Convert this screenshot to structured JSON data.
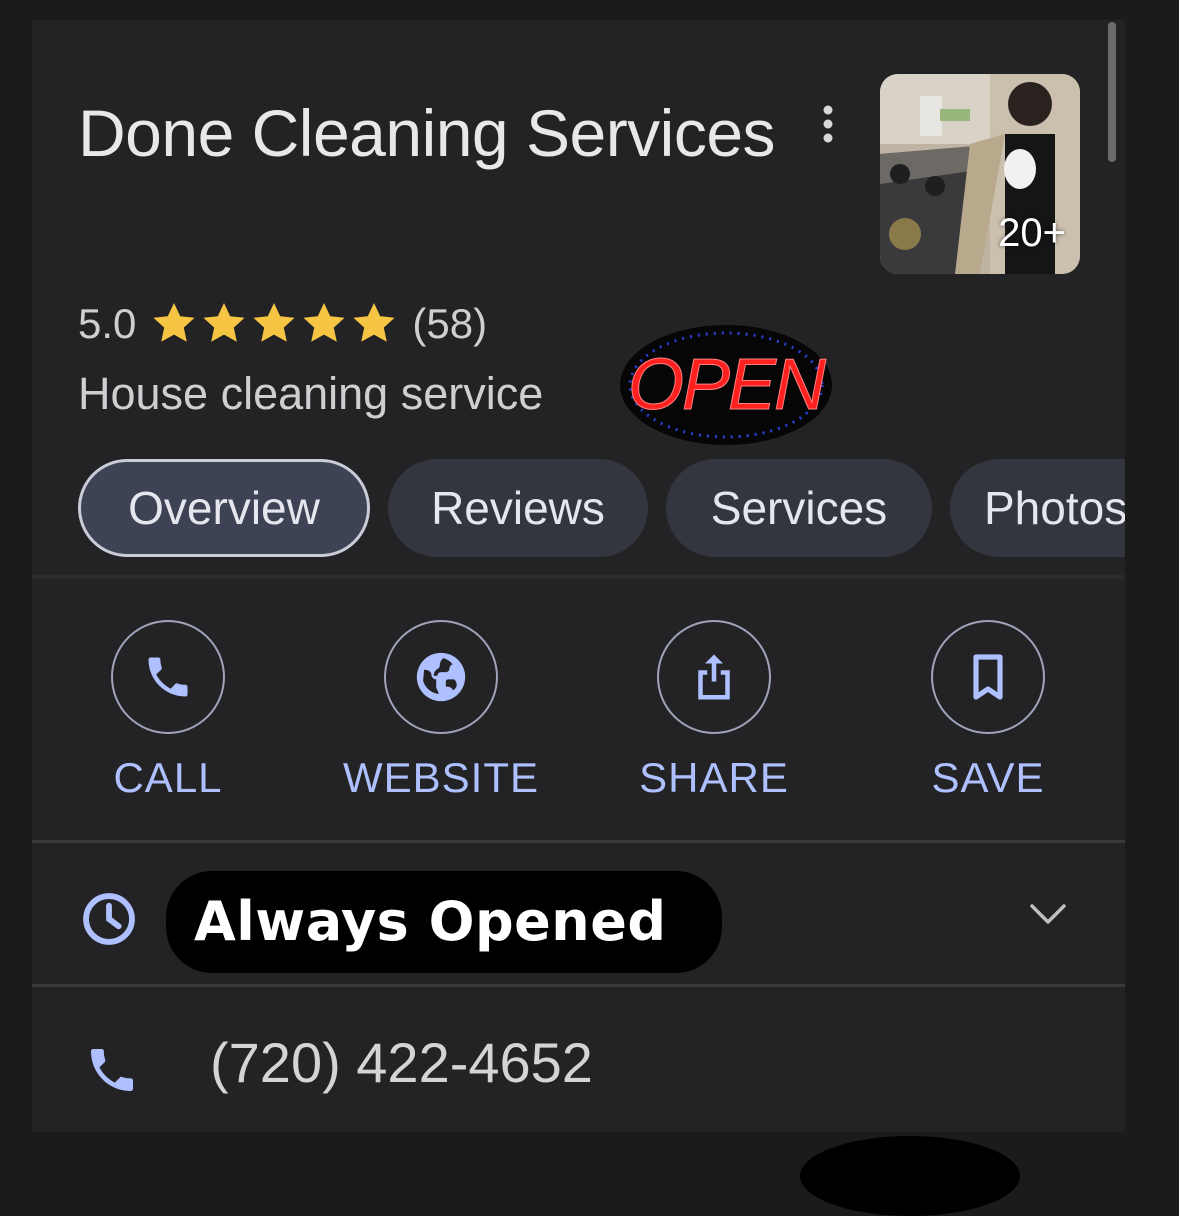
{
  "place": {
    "name": "Done Cleaning Services",
    "rating": "5.0",
    "stars": 5,
    "review_count": "(58)",
    "category": "House cleaning service",
    "photo_count": "20+"
  },
  "tabs": [
    {
      "label": "Overview",
      "active": true
    },
    {
      "label": "Reviews",
      "active": false
    },
    {
      "label": "Services",
      "active": false
    },
    {
      "label": "Photos",
      "active": false
    }
  ],
  "actions": {
    "call": {
      "label": "CALL",
      "icon": "phone-icon"
    },
    "website": {
      "label": "WEBSITE",
      "icon": "globe-icon"
    },
    "share": {
      "label": "SHARE",
      "icon": "share-icon"
    },
    "save": {
      "label": "SAVE",
      "icon": "bookmark-icon"
    }
  },
  "hours": {
    "text": "Always Opened",
    "icon": "clock-icon"
  },
  "phone": {
    "number": "(720) 422-4652",
    "icon": "phone-icon"
  },
  "sticker": {
    "text": "OPEN"
  },
  "colors": {
    "background": "#1b1b1c",
    "panel": "#232325",
    "accent": "#aec0ff",
    "star": "#f6c543",
    "tab_bg": "#34363f",
    "tab_active_bg": "#3d4254"
  }
}
